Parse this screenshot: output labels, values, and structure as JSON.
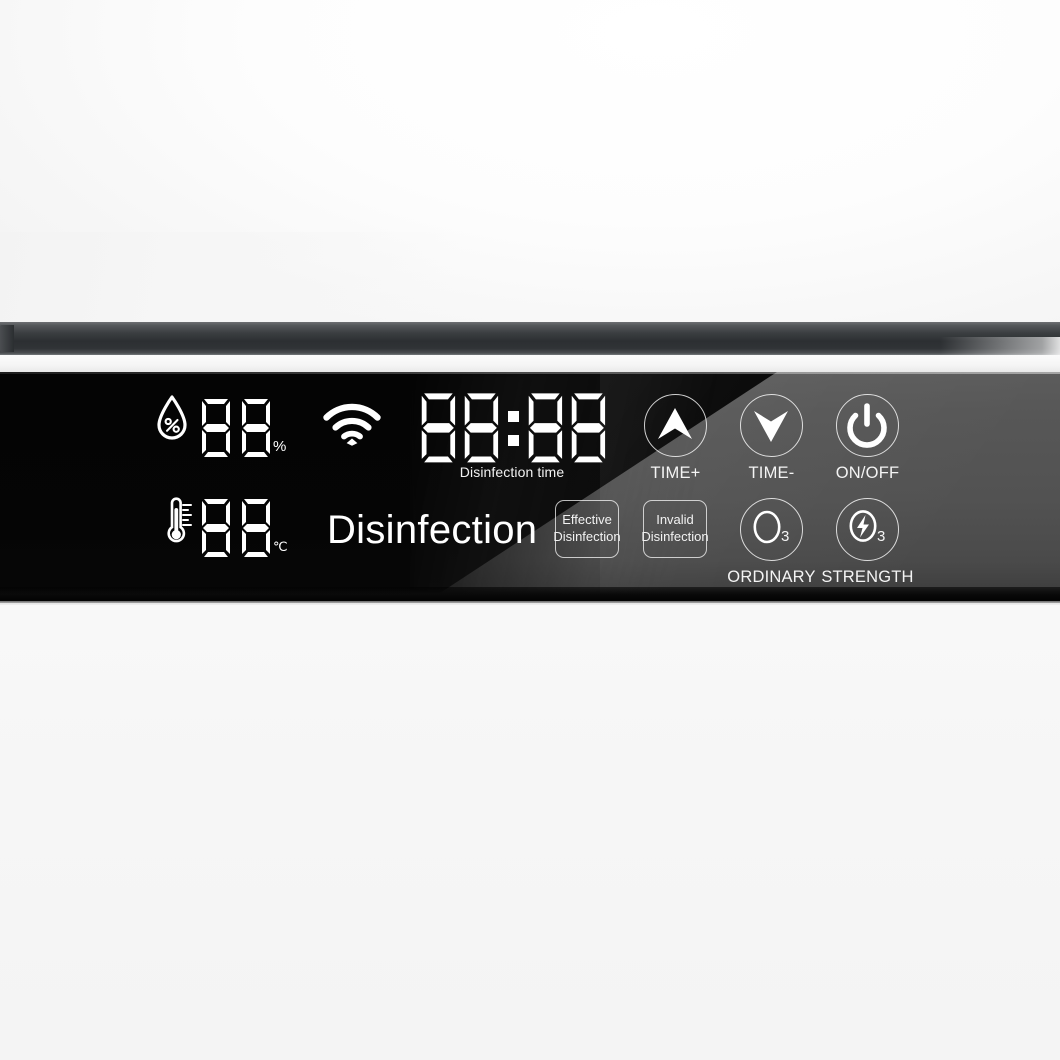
{
  "device": {
    "panel_kind": "disinfection-cabinet-control-panel",
    "colors": {
      "panel_gray": "#4f4f4f",
      "panel_black": "#050505",
      "body_white": "#f6f6f6",
      "trim_dark": "#2c2f32",
      "text_white": "#ffffff",
      "outline_white": "#e8e8e8"
    }
  },
  "display": {
    "humidity": {
      "icon": "water-droplet-percent-icon",
      "value": "88",
      "unit": "%"
    },
    "wifi": {
      "icon": "wifi-icon",
      "state": "connected"
    },
    "timer": {
      "value": "88:88",
      "hours": "88",
      "minutes": "88",
      "separator": ":",
      "label": "Disinfection time"
    },
    "temperature": {
      "icon": "thermometer-icon",
      "value": "88",
      "unit": "℃"
    },
    "mode": {
      "label": "Disinfection"
    }
  },
  "status_buttons": [
    {
      "name": "effective-disinfection",
      "line1": "Effective",
      "line2": "Disinfection"
    },
    {
      "name": "invalid-disinfection",
      "line1": "Invalid",
      "line2": "Disinfection"
    }
  ],
  "controls": {
    "top_row": [
      {
        "name": "time-plus",
        "icon": "chevron-up-icon",
        "label": "TIME+"
      },
      {
        "name": "time-minus",
        "icon": "chevron-down-icon",
        "label": "TIME-"
      },
      {
        "name": "on-off",
        "icon": "power-icon",
        "label": "ON/OFF"
      }
    ],
    "bottom_row": [
      {
        "name": "ordinary",
        "icon": "ozone-o3-icon",
        "glyph": "O",
        "sub": "3",
        "label": "ORDINARY"
      },
      {
        "name": "strength",
        "icon": "ozone-lightning-o3-icon",
        "glyph": "O",
        "sub": "3",
        "label": "STRENGTH"
      }
    ]
  }
}
